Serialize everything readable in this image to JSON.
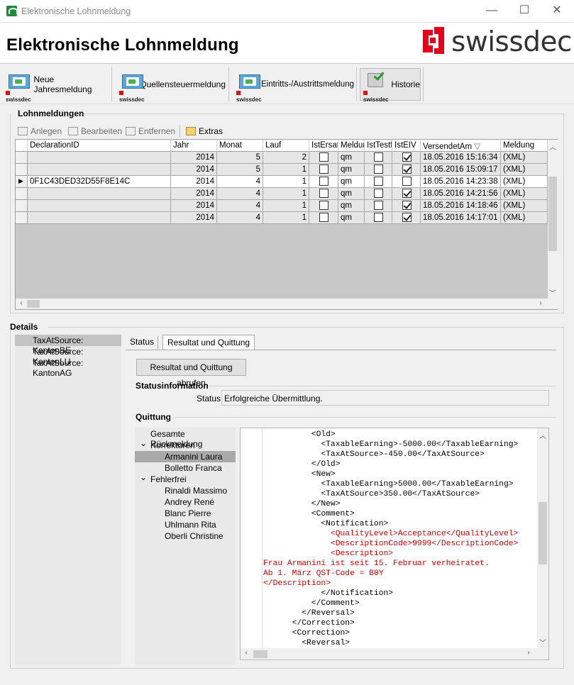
{
  "window": {
    "title": "Elektronische Lohnmeldung",
    "minimize_glyph": "—",
    "maximize_glyph": "☐",
    "close_glyph": "✕"
  },
  "header": {
    "heading": "Elektronische Lohnmeldung",
    "logo_text": "swissdec",
    "brand_color": "#e3001b"
  },
  "toolbar": {
    "buttons": [
      {
        "label": "Neue Jahresmeldung",
        "icon": "envelope-swissdec-icon"
      },
      {
        "label": "Quellensteuermeldung",
        "icon": "envelope-swissdec-icon"
      },
      {
        "label": "Eintritts-/Austrittsmeldung",
        "icon": "envelope-swissdec-icon"
      },
      {
        "label": "Historie",
        "icon": "history-check-icon"
      }
    ],
    "mini_brand": "swissdec"
  },
  "lohnmeldungen": {
    "title": "Lohnmeldungen",
    "actions": {
      "add": "Anlegen",
      "edit": "Bearbeiten",
      "remove": "Entfernen",
      "extras": "Extras"
    },
    "columns": [
      "DeclarationID",
      "Jahr",
      "Monat",
      "Lauf",
      "IstErsatz",
      "Meldun",
      "IstTestfa",
      "IstEIV",
      "VersendetAm",
      "Meldung"
    ],
    "sort_indicator": "▽",
    "rows": [
      {
        "id": "",
        "jahr": "2014",
        "monat": "5",
        "lauf": "2",
        "ersatz": false,
        "meldung_typ": "qm",
        "test": false,
        "eiv": true,
        "versendet": "18.05.2016 15:16:34",
        "meldung": "(XML)"
      },
      {
        "id": "",
        "jahr": "2014",
        "monat": "5",
        "lauf": "1",
        "ersatz": false,
        "meldung_typ": "qm",
        "test": false,
        "eiv": true,
        "versendet": "18.05.2016 15:09:17",
        "meldung": "(XML)"
      },
      {
        "id": "0F1C43DED32D55F8E14C",
        "jahr": "2014",
        "monat": "4",
        "lauf": "1",
        "ersatz": false,
        "meldung_typ": "qm",
        "test": false,
        "eiv": false,
        "versendet": "18.05.2016 14:23:38",
        "meldung": "(XML)"
      },
      {
        "id": "",
        "jahr": "2014",
        "monat": "4",
        "lauf": "1",
        "ersatz": false,
        "meldung_typ": "qm",
        "test": false,
        "eiv": true,
        "versendet": "18.05.2016 14:21:56",
        "meldung": "(XML)"
      },
      {
        "id": "",
        "jahr": "2014",
        "monat": "4",
        "lauf": "1",
        "ersatz": false,
        "meldung_typ": "qm",
        "test": false,
        "eiv": true,
        "versendet": "18.05.2016 14:18:46",
        "meldung": "(XML)"
      },
      {
        "id": "",
        "jahr": "2014",
        "monat": "4",
        "lauf": "1",
        "ersatz": false,
        "meldung_typ": "qm",
        "test": false,
        "eiv": true,
        "versendet": "18.05.2016 14:17:01",
        "meldung": "(XML)"
      }
    ],
    "current_row_marker": "▶"
  },
  "details": {
    "title": "Details",
    "recipients": [
      "TaxAtSource: KantonBE",
      "TaxAtSource: KantonLU",
      "TaxAtSource: KantonAG"
    ],
    "tabs": [
      "Status",
      "Resultat und Quittung"
    ],
    "fetch_button": "Resultat und Quittung abrufen",
    "statusinformation": {
      "title": "Statusinformation",
      "label": "Status",
      "value": "Erfolgreiche Übermittlung."
    },
    "quittung": {
      "title": "Quittung",
      "tree": [
        {
          "label": "Gesamte Rückmeldung",
          "level": 0,
          "toggle": ""
        },
        {
          "label": "Korrekturen",
          "level": 0,
          "toggle": "⌄"
        },
        {
          "label": "Armanini Laura",
          "level": 1,
          "toggle": ""
        },
        {
          "label": "Bolletto Franca",
          "level": 1,
          "toggle": ""
        },
        {
          "label": "Fehlerfrei",
          "level": 0,
          "toggle": "⌄"
        },
        {
          "label": "Rinaldi Massimo",
          "level": 1,
          "toggle": ""
        },
        {
          "label": "Andrey René",
          "level": 1,
          "toggle": ""
        },
        {
          "label": "Blanc Pierre",
          "level": 1,
          "toggle": ""
        },
        {
          "label": "Uhlmann Rita",
          "level": 1,
          "toggle": ""
        },
        {
          "label": "Oberli Christine",
          "level": 1,
          "toggle": ""
        }
      ],
      "xml_lines": [
        {
          "text": "          <Old>",
          "red": false
        },
        {
          "text": "            <TaxableEarning>-5000.00</TaxableEarning>",
          "red": false
        },
        {
          "text": "            <TaxAtSource>-450.00</TaxAtSource>",
          "red": false
        },
        {
          "text": "          </Old>",
          "red": false
        },
        {
          "text": "          <New>",
          "red": false
        },
        {
          "text": "            <TaxableEarning>5000.00</TaxableEarning>",
          "red": false
        },
        {
          "text": "            <TaxAtSource>350.00</TaxAtSource>",
          "red": false
        },
        {
          "text": "          </New>",
          "red": false
        },
        {
          "text": "          <Comment>",
          "red": false
        },
        {
          "text": "            <Notification>",
          "red": false
        },
        {
          "text": "              <QualityLevel>Acceptance</QualityLevel>",
          "red": true
        },
        {
          "text": "              <DescriptionCode>9999</DescriptionCode>",
          "red": true
        },
        {
          "text": "              <Description>",
          "red": true
        },
        {
          "text": "Frau Armanini ist seit 15. Februar verheiratet.",
          "red": true
        },
        {
          "text": "Ab 1. März QST-Code = B0Y",
          "red": true
        },
        {
          "text": "</Description>",
          "red": true
        },
        {
          "text": "            </Notification>",
          "red": false
        },
        {
          "text": "          </Comment>",
          "red": false
        },
        {
          "text": "        </Reversal>",
          "red": false
        },
        {
          "text": "      </Correction>",
          "red": false
        },
        {
          "text": "      <Correction>",
          "red": false
        },
        {
          "text": "        <Reversal>",
          "red": false
        }
      ]
    }
  }
}
